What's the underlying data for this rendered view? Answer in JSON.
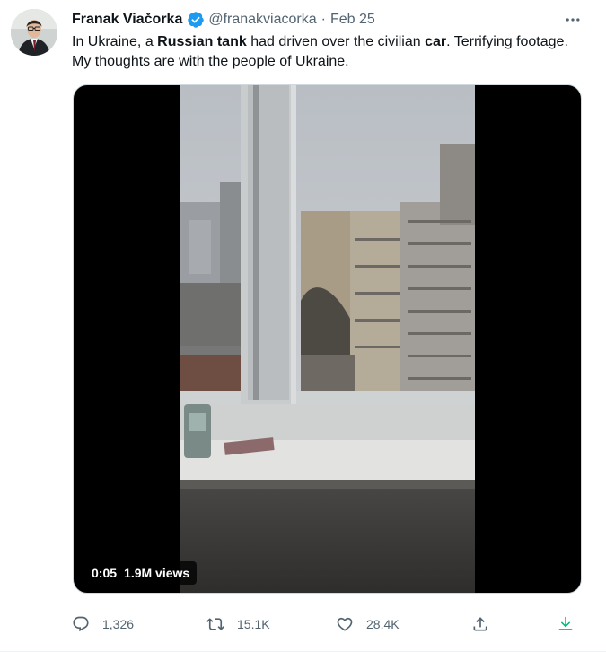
{
  "tweet": {
    "author_name": "Franak Viačorka",
    "handle": "@franakviacorka",
    "separator": "·",
    "date": "Feb 25",
    "text_parts": [
      {
        "text": "In Ukraine, a ",
        "bold": false
      },
      {
        "text": "Russian tank",
        "bold": true
      },
      {
        "text": " had driven over the civilian ",
        "bold": false
      },
      {
        "text": "car",
        "bold": true
      },
      {
        "text": ". Terrifying footage. My thoughts are with the people of Ukraine.",
        "bold": false
      }
    ],
    "video": {
      "time": "0:05",
      "views": "1.9M views"
    }
  },
  "actions": {
    "replies": "1,326",
    "retweets": "15.1K",
    "likes": "28.4K"
  },
  "icons": {
    "verified": "verified-badge-icon",
    "more": "more-horizontal-icon",
    "reply": "reply-icon",
    "retweet": "retweet-icon",
    "like": "heart-icon",
    "share": "share-icon",
    "download": "download-icon"
  },
  "colors": {
    "verified_blue": "#1d9bf0",
    "secondary_text": "#536471",
    "download_green": "#00ba7c"
  }
}
